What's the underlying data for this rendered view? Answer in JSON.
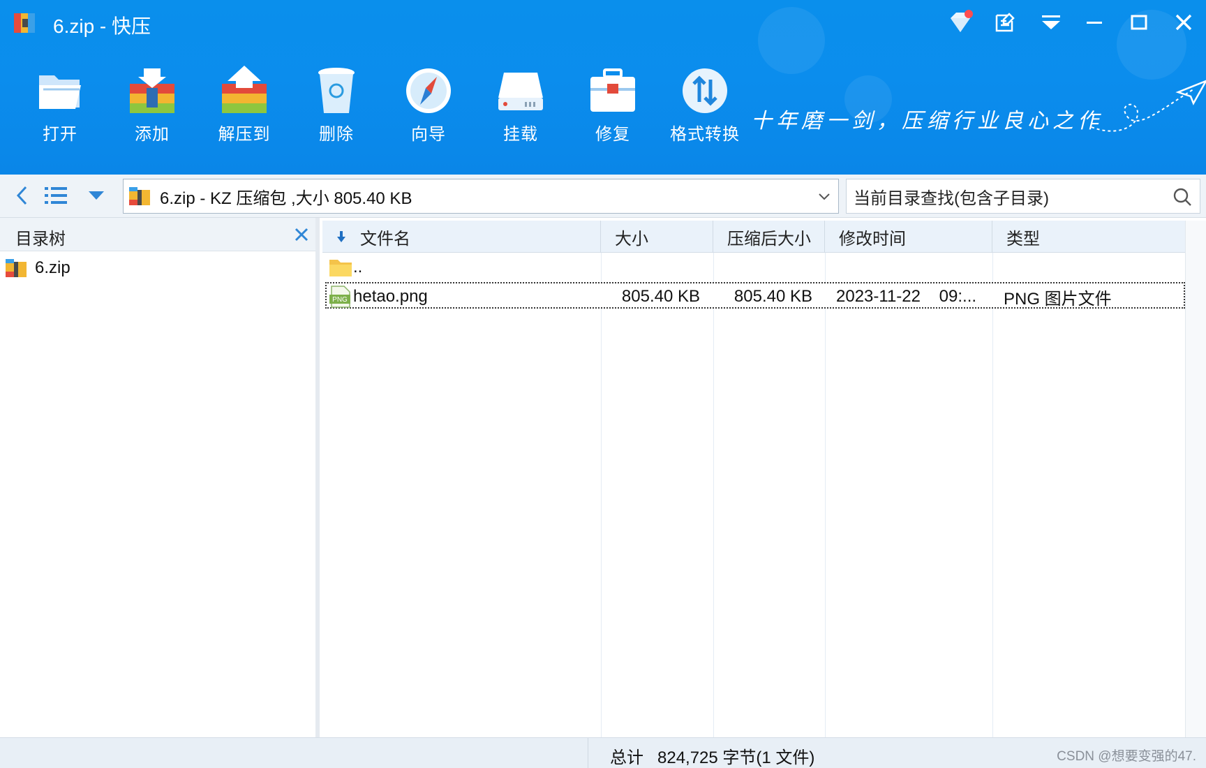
{
  "window": {
    "title": "6.zip - 快压",
    "controls": [
      "premium-icon",
      "feedback-icon",
      "menu-icon",
      "minimize-icon",
      "maximize-icon",
      "close-icon"
    ]
  },
  "toolbar": {
    "items": [
      {
        "label": "打开",
        "icon": "open-folder-icon"
      },
      {
        "label": "添加",
        "icon": "add-archive-icon"
      },
      {
        "label": "解压到",
        "icon": "extract-archive-icon"
      },
      {
        "label": "删除",
        "icon": "recycle-bin-icon"
      },
      {
        "label": "向导",
        "icon": "compass-icon"
      },
      {
        "label": "挂载",
        "icon": "drive-icon"
      },
      {
        "label": "修复",
        "icon": "toolbox-icon"
      },
      {
        "label": "格式转换",
        "icon": "convert-icon"
      }
    ],
    "slogan": "十年磨一剑，压缩行业良心之作"
  },
  "nav": {
    "address": "6.zip - KZ 压缩包 ,大小 805.40 KB",
    "search_placeholder": "当前目录查找(包含子目录)"
  },
  "tree": {
    "title": "目录树",
    "root": "6.zip"
  },
  "list": {
    "columns": [
      "文件名",
      "大小",
      "压缩后大小",
      "修改时间",
      "类型"
    ],
    "rows": [
      {
        "name": "..",
        "size": "",
        "packed": "",
        "modified": "",
        "type": "",
        "icon": "folder-icon"
      },
      {
        "name": "hetao.png",
        "size": "805.40 KB",
        "packed": "805.40 KB",
        "modified": "2023-11-22    09:...",
        "type": "PNG 图片文件",
        "icon": "png-file-icon"
      }
    ]
  },
  "status": {
    "summary": "总计   824,725 字节(1 文件)",
    "watermark": "CSDN @想要变强的47."
  },
  "colors": {
    "accent": "#0a8fec",
    "header_bg": "#eaf2fa",
    "status_bg": "#e8eff6"
  }
}
